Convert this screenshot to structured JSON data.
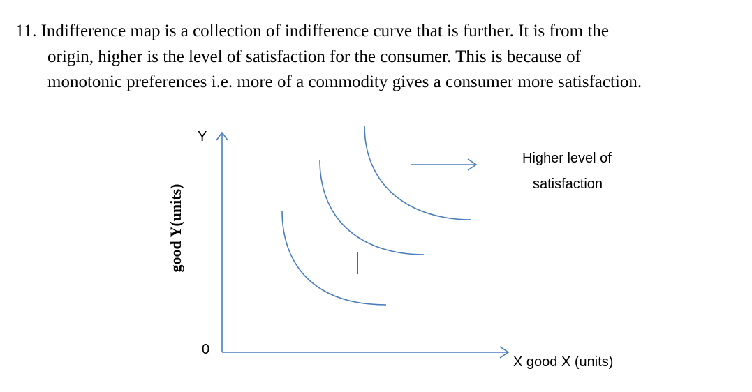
{
  "paragraph": {
    "lines": [
      "11. Indifference map is a collection of indifference curve that is further. It is from the",
      "origin, higher is the level of satisfaction for the consumer. This is because of",
      "monotonic preferences i.e. more of a commodity gives a consumer more satisfaction."
    ]
  },
  "diagram": {
    "y_axis_letter": "Y",
    "y_axis_title": "good Y(units)",
    "origin_label": "0",
    "x_axis_title": "X good X (units)",
    "annotation_line1": "Higher level of",
    "annotation_line2": "satisfaction",
    "line_color": "#4a7ebb",
    "curve_count": 3
  }
}
